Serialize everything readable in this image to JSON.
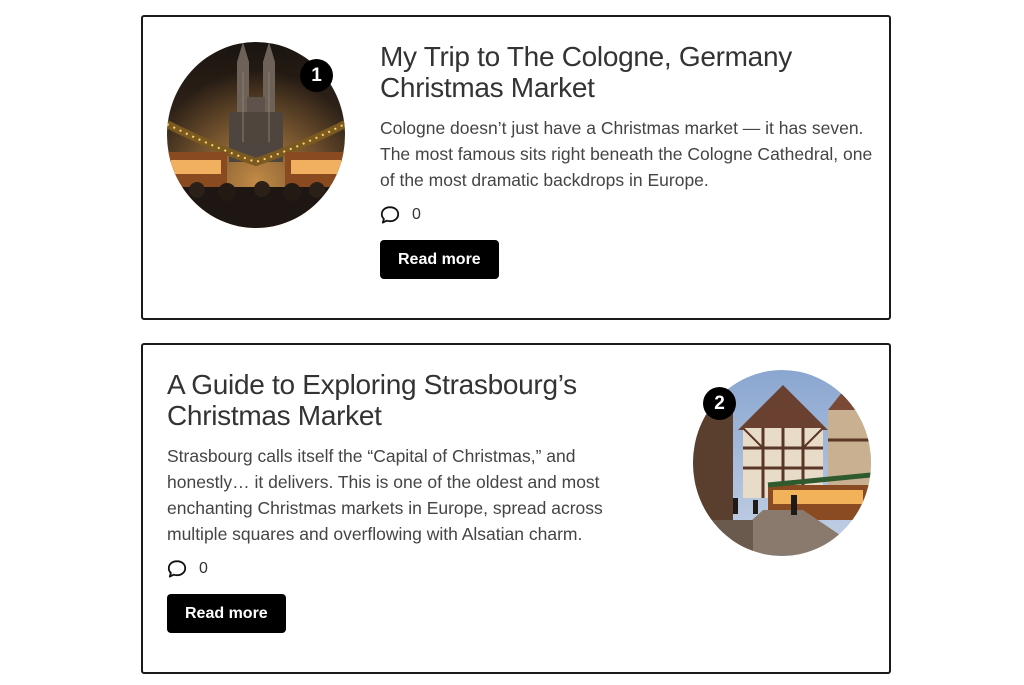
{
  "posts": [
    {
      "number": "1",
      "title": "My Trip to The Cologne, Germany Christmas Market",
      "excerpt": "Cologne doesn’t just have a Christmas market — it has seven. The most famous sits right beneath the Cologne Cathedral, one of the most dramatic backdrops in Europe.",
      "comment_count": "0",
      "button_label": "Read more",
      "image_icon": "cathedral-market-photo"
    },
    {
      "number": "2",
      "title": "A Guide to Exploring Strasbourg’s Christmas Market",
      "excerpt": "Strasbourg calls itself the “Capital of Christmas,” and honestly… it delivers. This is one of the oldest and most enchanting Christmas markets in Europe, spread across multiple squares and overflowing with Alsatian charm.",
      "comment_count": "0",
      "button_label": "Read more",
      "image_icon": "half-timbered-street-photo"
    }
  ],
  "colors": {
    "accent": "#000000",
    "border": "#1a1a1a",
    "text": "#333333"
  },
  "icons": {
    "comment": "speech-bubble-icon"
  }
}
